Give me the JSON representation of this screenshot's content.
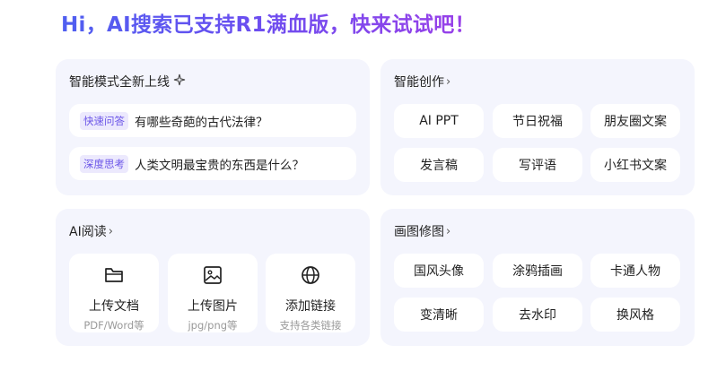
{
  "headline": "Hi，AI搜索已支持R1满血版，快来试试吧！",
  "smart_mode": {
    "title": "智能模式全新上线",
    "title_icon": "sparkle-icon",
    "items": [
      {
        "tag": "快速问答",
        "question": "有哪些奇葩的古代法律？"
      },
      {
        "tag": "深度思考",
        "question": "人类文明最宝贵的东西是什么？"
      }
    ]
  },
  "creation": {
    "title": "智能创作",
    "chevron": "›",
    "items": [
      "AI PPT",
      "节日祝福",
      "朋友圈文案",
      "发言稿",
      "写评语",
      "小红书文案"
    ]
  },
  "reading": {
    "title": "AI阅读",
    "chevron": "›",
    "items": [
      {
        "icon": "folder-icon",
        "label": "上传文档",
        "sub": "PDF/Word等"
      },
      {
        "icon": "image-icon",
        "label": "上传图片",
        "sub": "jpg/png等"
      },
      {
        "icon": "globe-icon",
        "label": "添加链接",
        "sub": "支持各类链接"
      }
    ]
  },
  "drawing": {
    "title": "画图修图",
    "chevron": "›",
    "items": [
      "国风头像",
      "涂鸦插画",
      "卡通人物",
      "变清晰",
      "去水印",
      "换风格"
    ]
  },
  "colors": {
    "accent": "#6b55e8",
    "card_bg": "#f4f5fd",
    "gradient_start": "#4f5ff0",
    "gradient_end": "#9b3fe8"
  }
}
